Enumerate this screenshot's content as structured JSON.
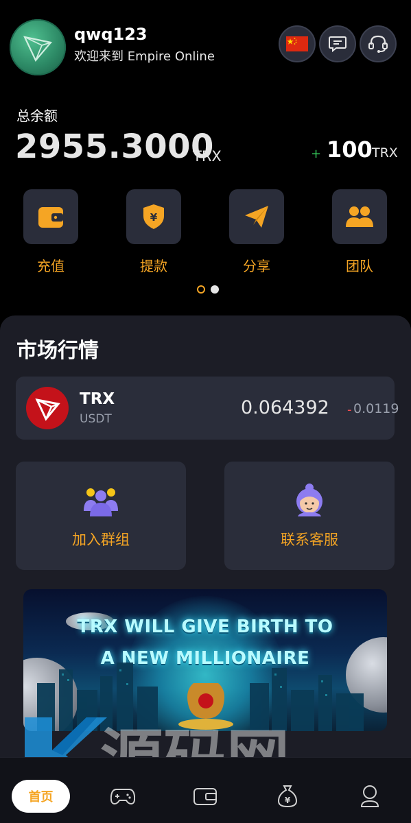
{
  "header": {
    "username": "qwq123",
    "welcome": "欢迎来到 Empire Online",
    "buttons": [
      "flag-cn-icon",
      "message-icon",
      "headset-icon"
    ]
  },
  "balance": {
    "label": "总余额",
    "value": "2955.3000",
    "unit": "TRX",
    "bonus_sign": "+",
    "bonus_value": "100",
    "bonus_unit": "TRX"
  },
  "actions": [
    {
      "label": "充值",
      "icon": "wallet-icon"
    },
    {
      "label": "提款",
      "icon": "shield-yen-icon"
    },
    {
      "label": "分享",
      "icon": "paper-plane-icon"
    },
    {
      "label": "团队",
      "icon": "team-icon"
    }
  ],
  "carousel": {
    "pages": 2,
    "active": 0
  },
  "market": {
    "title": "市场行情",
    "ticker": {
      "base": "TRX",
      "quote": "USDT",
      "price": "0.064392",
      "change_sign": "-",
      "change": "0.0119"
    }
  },
  "cards": [
    {
      "label": "加入群组",
      "icon": "group-icon"
    },
    {
      "label": "联系客服",
      "icon": "support-agent-icon"
    }
  ],
  "banner": {
    "line1": "TRX WILL GIVE BIRTH  TO",
    "line2": "A NEW MILLIONAIRE"
  },
  "watermark": {
    "text": "源码网"
  },
  "nav": {
    "home_label": "首页",
    "items": [
      "gamepad-icon",
      "wallet-icon",
      "money-bag-icon",
      "profile-icon"
    ]
  },
  "colors": {
    "accent": "#f5a524",
    "panel": "#1c1d26",
    "card": "#2a2d3a",
    "positive": "#34c759",
    "negative": "#ff4d4f",
    "trx_red": "#c4121a"
  }
}
